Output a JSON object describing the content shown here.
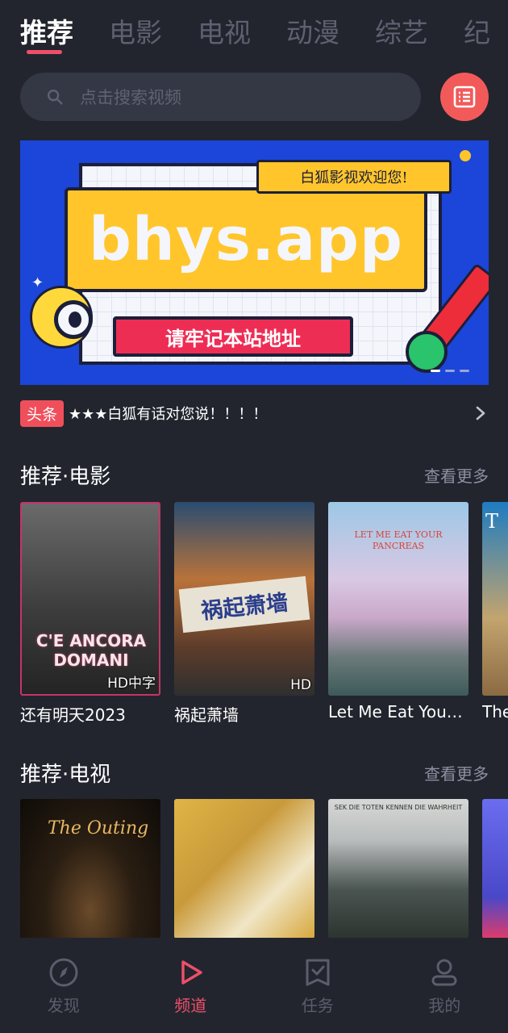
{
  "tabs": [
    "推荐",
    "电影",
    "电视",
    "动漫",
    "综艺",
    "纪"
  ],
  "search": {
    "placeholder": "点击搜索视频"
  },
  "banner": {
    "tag": "白狐影视欢迎您!",
    "domain": "bhys.app",
    "subtitle": "请牢记本站地址"
  },
  "headline": {
    "tag": "头条",
    "text": "★★★白狐有话对您说！！！！"
  },
  "movies": {
    "title": "推荐·电影",
    "more": "查看更多",
    "items": [
      {
        "title": "还有明天2023",
        "badge": "HD中字",
        "poster_text": "C'E ANCORA DOMANI"
      },
      {
        "title": "祸起萧墙",
        "badge": "HD",
        "poster_text": "祸起萧墙"
      },
      {
        "title": "Let Me Eat Your Pancreas",
        "badge": "",
        "poster_text": "LET ME EAT YOUR PANCREAS"
      },
      {
        "title": "The",
        "badge": "",
        "poster_text": "T"
      }
    ]
  },
  "tv": {
    "title": "推荐·电视",
    "more": "查看更多",
    "items": [
      {
        "poster_text": "The Outing"
      },
      {
        "poster_text": ""
      },
      {
        "poster_text": "SEK DIE TOTEN KENNEN DIE WAHRHEIT"
      },
      {
        "poster_text": ""
      }
    ]
  },
  "nav": [
    {
      "label": "发现",
      "icon": "compass-icon",
      "active": false
    },
    {
      "label": "频道",
      "icon": "play-icon",
      "active": true
    },
    {
      "label": "任务",
      "icon": "task-icon",
      "active": false
    },
    {
      "label": "我的",
      "icon": "user-icon",
      "active": false
    }
  ],
  "colors": {
    "accent": "#ef4f6a",
    "background": "#22252e",
    "history_button": "#f25a5a"
  }
}
